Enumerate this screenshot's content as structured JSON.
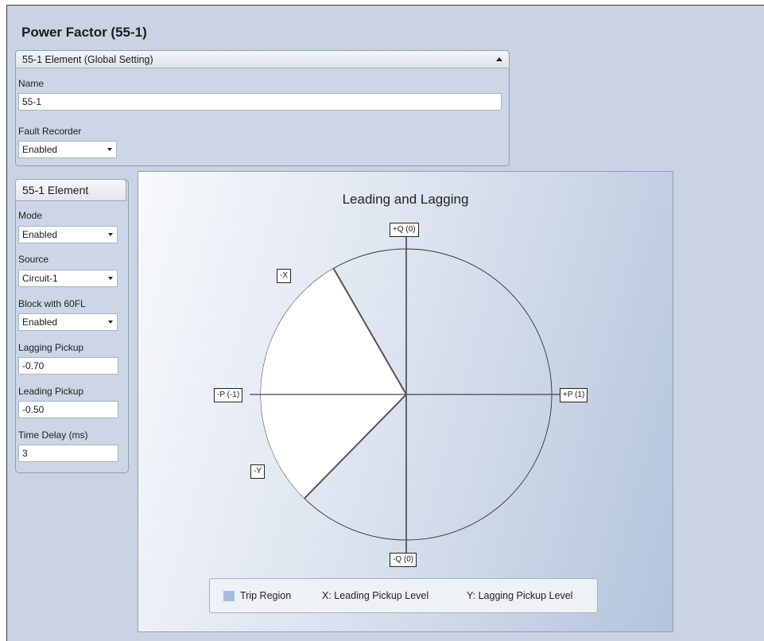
{
  "page": {
    "title": "Power Factor (55-1)"
  },
  "global_panel": {
    "header": "55-1 Element (Global Setting)",
    "name_label": "Name",
    "name_value": "55-1",
    "fault_recorder_label": "Fault Recorder",
    "fault_recorder_value": "Enabled"
  },
  "element_panel": {
    "header": "55-1 Element",
    "mode_label": "Mode",
    "mode_value": "Enabled",
    "source_label": "Source",
    "source_value": "Circuit-1",
    "block_label": "Block with 60FL",
    "block_value": "Enabled",
    "lagging_label": "Lagging Pickup",
    "lagging_value": "-0.70",
    "leading_label": "Leading Pickup",
    "leading_value": "-0.50",
    "delay_label": "Time Delay (ms)",
    "delay_value": "3"
  },
  "chart_data": {
    "type": "polar-diagram",
    "title": "Leading and Lagging",
    "axis_labels": {
      "top": "+Q (0)",
      "bottom": "-Q (0)",
      "left": "-P (-1)",
      "right": "+P (1)"
    },
    "pickup_markers": {
      "leading": {
        "label": "-X",
        "power_factor": -0.5
      },
      "lagging": {
        "label": "-Y",
        "power_factor": -0.7
      }
    },
    "trip_region_color": "#ffffff",
    "legend": {
      "swatch_color": "#a9bcd9",
      "items": [
        "Trip Region",
        "X: Leading Pickup Level",
        "Y: Lagging Pickup Level"
      ]
    }
  }
}
